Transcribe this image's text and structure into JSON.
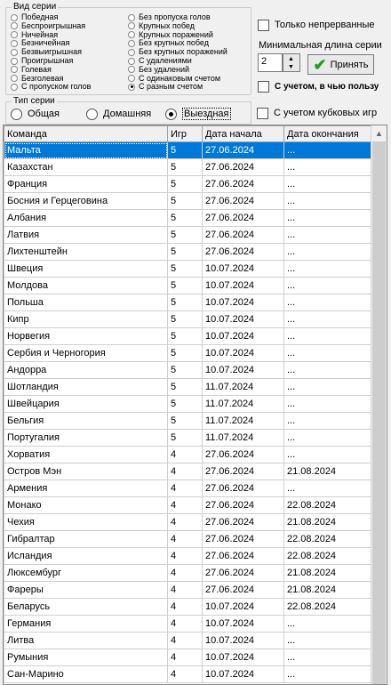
{
  "series_type_group": {
    "legend": "Вид серии",
    "left": [
      {
        "label": "Победная",
        "checked": false
      },
      {
        "label": "Беспроигрышная",
        "checked": false
      },
      {
        "label": "Ничейная",
        "checked": false
      },
      {
        "label": "Безничейная",
        "checked": false
      },
      {
        "label": "Безвыигрышная",
        "checked": false
      },
      {
        "label": "Проигрышная",
        "checked": false
      },
      {
        "label": "Голевая",
        "checked": false
      },
      {
        "label": "Безголевая",
        "checked": false
      },
      {
        "label": "С пропуском голов",
        "checked": false
      }
    ],
    "right": [
      {
        "label": "Без пропуска голов",
        "checked": false
      },
      {
        "label": "Крупных побед",
        "checked": false
      },
      {
        "label": "Крупных поражений",
        "checked": false
      },
      {
        "label": "Без крупных побед",
        "checked": false
      },
      {
        "label": "Без крупных поражений",
        "checked": false
      },
      {
        "label": "С удалениями",
        "checked": false
      },
      {
        "label": "Без удалений",
        "checked": false
      },
      {
        "label": "С одинаковым счетом",
        "checked": false
      },
      {
        "label": "С разным счетом",
        "checked": true
      }
    ]
  },
  "options": {
    "only_continuous": "Только непрерванные",
    "min_length_label": "Минимальная длина серии",
    "min_length_value": "2",
    "apply_label": "Принять",
    "whose_favor": "С учетом, в чью пользу",
    "cup_games": "С учетом кубковых игр"
  },
  "venue_group": {
    "legend": "Тип серии",
    "options": [
      {
        "label": "Общая",
        "checked": false
      },
      {
        "label": "Домашняя",
        "checked": false
      },
      {
        "label": "Выездная",
        "checked": true
      }
    ]
  },
  "table": {
    "headers": [
      "Команда",
      "Игр",
      "Дата начала",
      "Дата окончания"
    ],
    "rows": [
      [
        "Мальта",
        "5",
        "27.06.2024",
        "..."
      ],
      [
        "Казахстан",
        "5",
        "27.06.2024",
        "..."
      ],
      [
        "Франция",
        "5",
        "27.06.2024",
        "..."
      ],
      [
        "Босния и Герцеговина",
        "5",
        "27.06.2024",
        "..."
      ],
      [
        "Албания",
        "5",
        "27.06.2024",
        "..."
      ],
      [
        "Латвия",
        "5",
        "27.06.2024",
        "..."
      ],
      [
        "Лихтенштейн",
        "5",
        "27.06.2024",
        "..."
      ],
      [
        "Швеция",
        "5",
        "10.07.2024",
        "..."
      ],
      [
        "Молдова",
        "5",
        "10.07.2024",
        "..."
      ],
      [
        "Польша",
        "5",
        "10.07.2024",
        "..."
      ],
      [
        "Кипр",
        "5",
        "10.07.2024",
        "..."
      ],
      [
        "Норвегия",
        "5",
        "10.07.2024",
        "..."
      ],
      [
        "Сербия и Черногория",
        "5",
        "10.07.2024",
        "..."
      ],
      [
        "Андорра",
        "5",
        "10.07.2024",
        "..."
      ],
      [
        "Шотландия",
        "5",
        "11.07.2024",
        "..."
      ],
      [
        "Швейцария",
        "5",
        "11.07.2024",
        "..."
      ],
      [
        "Бельгия",
        "5",
        "11.07.2024",
        "..."
      ],
      [
        "Португалия",
        "5",
        "11.07.2024",
        "..."
      ],
      [
        "Хорватия",
        "4",
        "27.06.2024",
        "..."
      ],
      [
        "Остров Мэн",
        "4",
        "27.06.2024",
        "21.08.2024"
      ],
      [
        "Армения",
        "4",
        "27.06.2024",
        "..."
      ],
      [
        "Монако",
        "4",
        "27.06.2024",
        "22.08.2024"
      ],
      [
        "Чехия",
        "4",
        "27.06.2024",
        "21.08.2024"
      ],
      [
        "Гибралтар",
        "4",
        "27.06.2024",
        "22.08.2024"
      ],
      [
        "Исландия",
        "4",
        "27.06.2024",
        "22.08.2024"
      ],
      [
        "Люксембург",
        "4",
        "27.06.2024",
        "21.08.2024"
      ],
      [
        "Фареры",
        "4",
        "27.06.2024",
        "21.08.2024"
      ],
      [
        "Беларусь",
        "4",
        "10.07.2024",
        "22.08.2024"
      ],
      [
        "Германия",
        "4",
        "10.07.2024",
        "..."
      ],
      [
        "Литва",
        "4",
        "10.07.2024",
        "..."
      ],
      [
        "Румыния",
        "4",
        "10.07.2024",
        "..."
      ],
      [
        "Сан-Марино",
        "4",
        "10.07.2024",
        "..."
      ]
    ],
    "selected_index": 0
  }
}
